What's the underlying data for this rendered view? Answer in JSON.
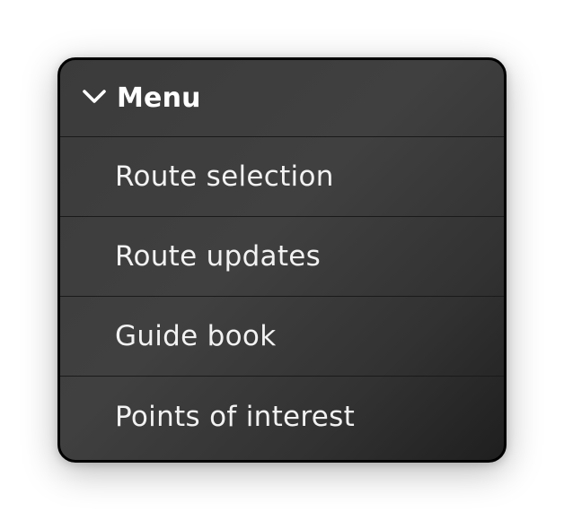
{
  "menu": {
    "title": "Menu",
    "toggle_icon": "chevron-down-icon",
    "items": [
      {
        "label": "Route selection"
      },
      {
        "label": "Route updates"
      },
      {
        "label": "Guide book"
      },
      {
        "label": "Points of interest"
      }
    ]
  },
  "colors": {
    "panel_background": "#3b3b3b",
    "panel_border": "#000000",
    "divider": "#1a1a1a",
    "text": "#ffffff"
  }
}
